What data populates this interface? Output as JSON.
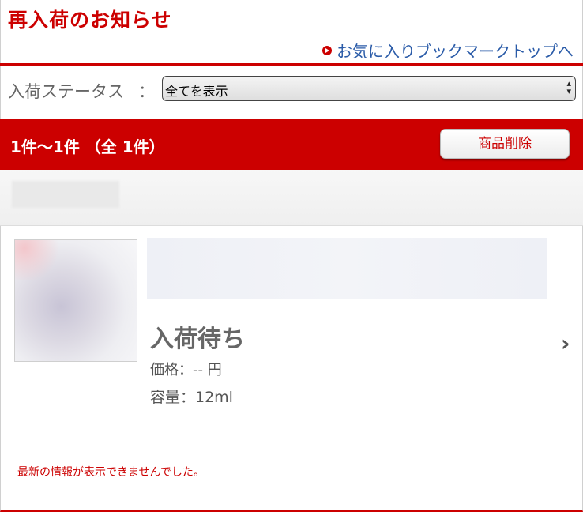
{
  "header": {
    "title": "再入荷のお知らせ",
    "top_link": "お気に入りブックマークトップへ"
  },
  "filter": {
    "label": "入荷ステータス",
    "colon": "：",
    "selected": "全てを表示"
  },
  "results": {
    "count_text": "1件〜1件 （全 1件）",
    "delete_button": "商品削除"
  },
  "item": {
    "status": "入荷待ち",
    "price": "価格：-- 円",
    "volume": "容量：12ml"
  },
  "notice": "最新の情報が表示できませんでした。",
  "colors": {
    "brand_red": "#cc0000",
    "link_blue": "#2a5ba8"
  },
  "icons": [
    "circle-arrow-icon",
    "select-arrows-icon",
    "chevron-right-icon"
  ]
}
